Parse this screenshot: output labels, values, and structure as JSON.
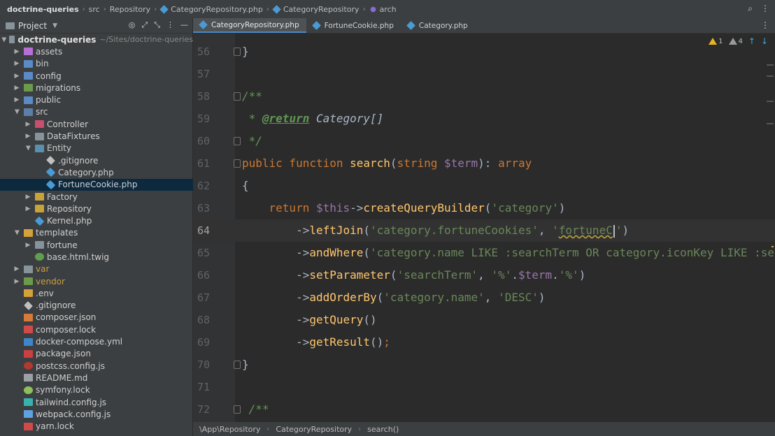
{
  "navbar": {
    "crumbs": [
      "doctrine-queries",
      "src",
      "Repository",
      "CategoryRepository.php",
      "CategoryRepository",
      "arch"
    ]
  },
  "project": {
    "title": "Project",
    "tree": [
      {
        "label": "doctrine-queries",
        "hint": "~/Sites/doctrine-queries"
      },
      {
        "label": "assets"
      },
      {
        "label": "bin"
      },
      {
        "label": "config"
      },
      {
        "label": "migrations"
      },
      {
        "label": "public"
      },
      {
        "label": "src"
      },
      {
        "label": "Controller"
      },
      {
        "label": "DataFixtures"
      },
      {
        "label": "Entity"
      },
      {
        "label": ".gitignore"
      },
      {
        "label": "Category.php"
      },
      {
        "label": "FortuneCookie.php"
      },
      {
        "label": "Factory"
      },
      {
        "label": "Repository"
      },
      {
        "label": "Kernel.php"
      },
      {
        "label": "templates"
      },
      {
        "label": "fortune"
      },
      {
        "label": "base.html.twig"
      },
      {
        "label": "var"
      },
      {
        "label": "vendor"
      },
      {
        "label": ".env"
      },
      {
        "label": ".gitignore"
      },
      {
        "label": "composer.json"
      },
      {
        "label": "composer.lock"
      },
      {
        "label": "docker-compose.yml"
      },
      {
        "label": "package.json"
      },
      {
        "label": "postcss.config.js"
      },
      {
        "label": "README.md"
      },
      {
        "label": "symfony.lock"
      },
      {
        "label": "tailwind.config.js"
      },
      {
        "label": "webpack.config.js"
      },
      {
        "label": "yarn.lock"
      }
    ]
  },
  "tabs": [
    {
      "label": "CategoryRepository.php"
    },
    {
      "label": "FortuneCookie.php"
    },
    {
      "label": "Category.php"
    }
  ],
  "editor": {
    "warnings": "1",
    "weak_warnings": "4",
    "line_numbers": [
      "56",
      "57",
      "58",
      "59",
      "60",
      "61",
      "62",
      "63",
      "64",
      "65",
      "66",
      "67",
      "68",
      "69",
      "70",
      "71",
      "72"
    ],
    "code": {
      "l56": "}",
      "l58": "/**",
      "l59_star": " * ",
      "l59_tag": "@return",
      "l59_type": " Category[]",
      "l60": " */",
      "l61_kw1": "public function ",
      "l61_fn": "search",
      "l61_p1": "(",
      "l61_type": "string ",
      "l61_var": "$term",
      "l61_p2": "): ",
      "l61_kw2": "array",
      "l62": "{",
      "l63_indent": "    ",
      "l63_kw": "return ",
      "l63_var": "$this",
      "l63_arrow": "->",
      "l63_fn": "createQueryBuilder",
      "l63_p1": "(",
      "l63_str": "'category'",
      "l63_p2": ")",
      "l64_indent": "        ->",
      "l64_fn": "leftJoin",
      "l64_p1": "(",
      "l64_str1": "'category.fortuneCookies'",
      "l64_comma": ", ",
      "l64_str2a": "'",
      "l64_str2b": "fortuneC",
      "l64_str2c": "'",
      "l64_p2": ")",
      "l65_indent": "        ->",
      "l65_fn": "andWhere",
      "l65_p1": "(",
      "l65_str": "'category.name LIKE :searchTerm OR category.iconKey LIKE :sea",
      "l66_indent": "        ->",
      "l66_fn": "setParameter",
      "l66_p1": "(",
      "l66_str1": "'searchTerm'",
      "l66_comma": ", ",
      "l66_str2": "'%'",
      "l66_dot1": ".",
      "l66_var": "$term",
      "l66_dot2": ".",
      "l66_str3": "'%'",
      "l66_p2": ")",
      "l67_indent": "        ->",
      "l67_fn": "addOrderBy",
      "l67_p1": "(",
      "l67_str1": "'category.name'",
      "l67_comma": ", ",
      "l67_str2": "'DESC'",
      "l67_p2": ")",
      "l68_indent": "        ->",
      "l68_fn": "getQuery",
      "l68_p": "()",
      "l69_indent": "        ->",
      "l69_fn": "getResult",
      "l69_p": "()",
      "l69_semi": ";",
      "l70": "}",
      "l72": " /**"
    }
  },
  "bottom_breadcrumb": [
    "\\App\\Repository",
    "CategoryRepository",
    "search()"
  ]
}
